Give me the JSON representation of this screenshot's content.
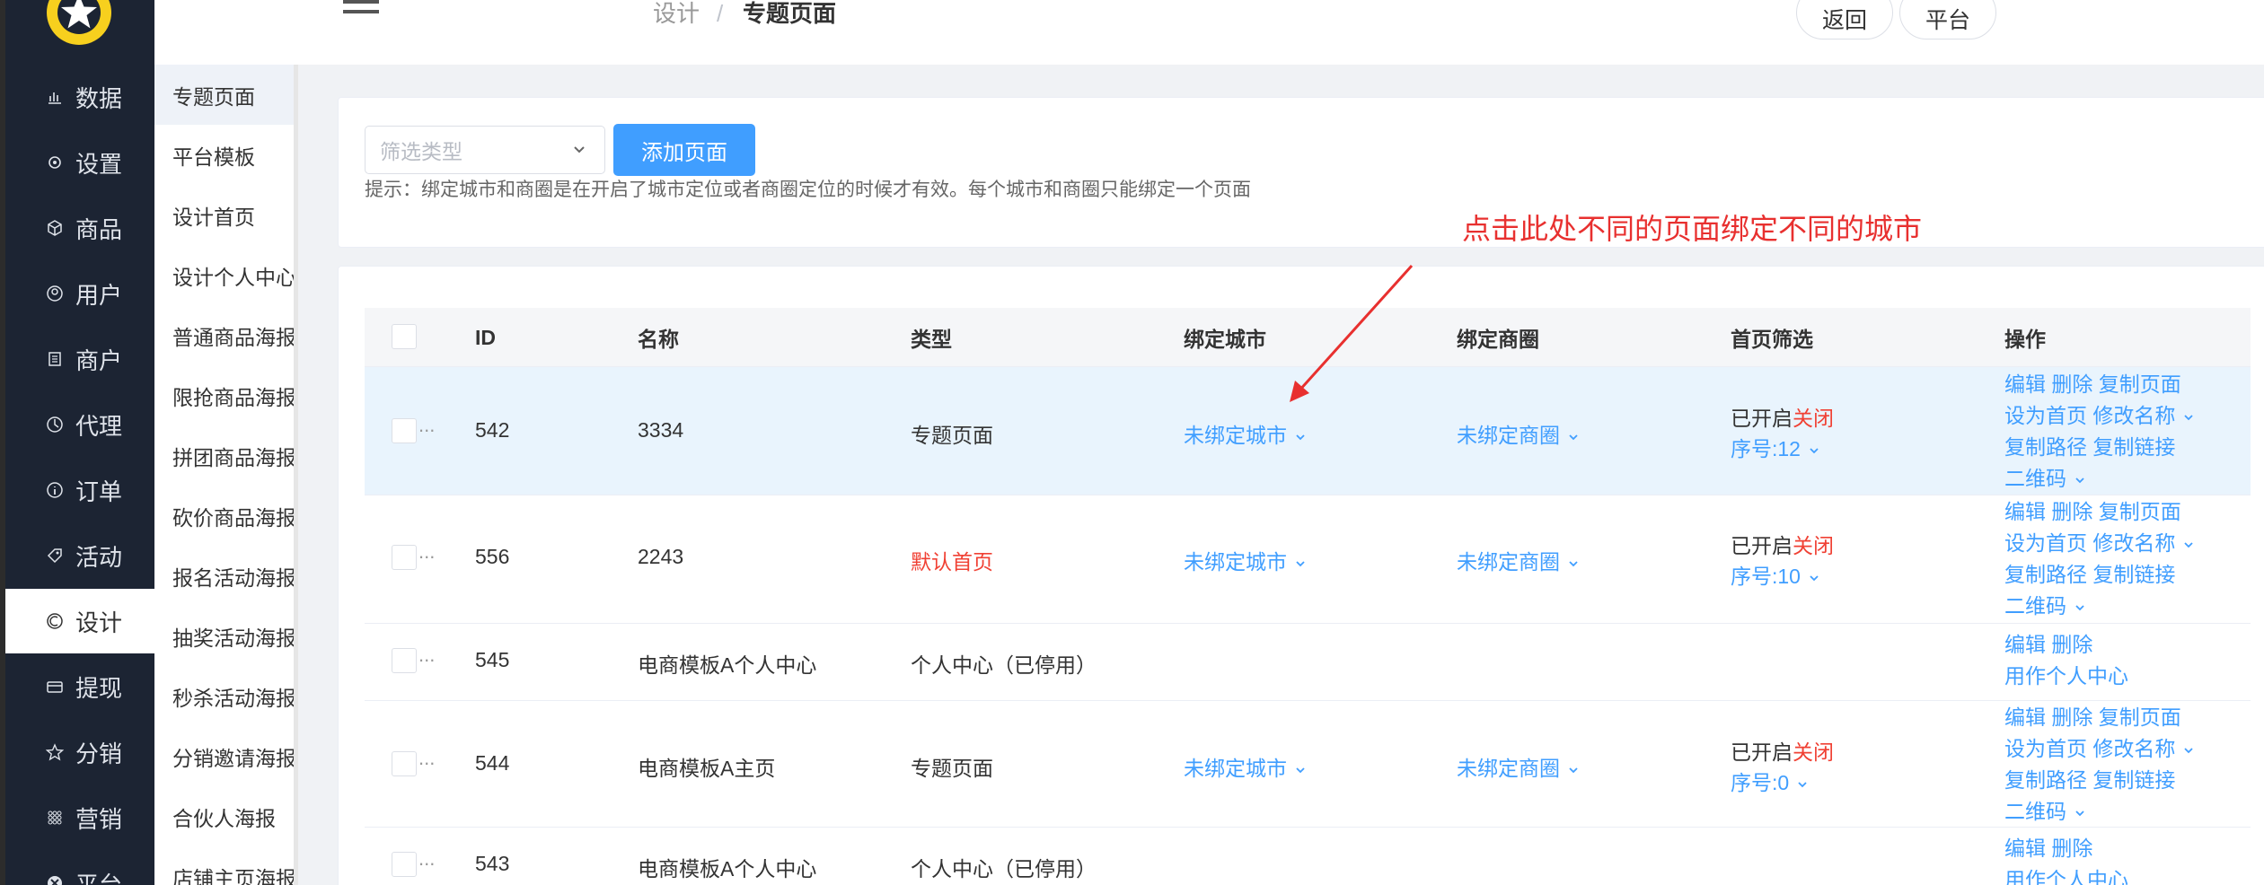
{
  "nav": {
    "items": [
      {
        "label": "数据",
        "icon": "chart-icon"
      },
      {
        "label": "设置",
        "icon": "gear-icon"
      },
      {
        "label": "商品",
        "icon": "cube-icon"
      },
      {
        "label": "用户",
        "icon": "user-icon"
      },
      {
        "label": "商户",
        "icon": "store-icon"
      },
      {
        "label": "代理",
        "icon": "agent-icon"
      },
      {
        "label": "订单",
        "icon": "order-icon"
      },
      {
        "label": "活动",
        "icon": "tag-icon"
      },
      {
        "label": "设计",
        "icon": "design-icon"
      },
      {
        "label": "提现",
        "icon": "card-icon"
      },
      {
        "label": "分销",
        "icon": "star-icon"
      },
      {
        "label": "营销",
        "icon": "grid-icon"
      },
      {
        "label": "平台",
        "icon": "platform-icon"
      }
    ],
    "active": "设计"
  },
  "subnav": {
    "items": [
      "专题页面",
      "平台模板",
      "设计首页",
      "设计个人中心",
      "普通商品海报",
      "限抢商品海报",
      "拼团商品海报",
      "砍价商品海报",
      "报名活动海报",
      "抽奖活动海报",
      "秒杀活动海报",
      "分销邀请海报",
      "合伙人海报",
      "店铺主页海报"
    ]
  },
  "header": {
    "breadcrumb": [
      "设计",
      "/",
      "专题页面"
    ],
    "back_label": "返回",
    "platform_label": "平台"
  },
  "filter": {
    "placeholder": "筛选类型",
    "add_label": "添加页面",
    "tip": "提示：绑定城市和商圈是在开启了城市定位或者商圈定位的时候才有效。每个城市和商圈只能绑定一个页面"
  },
  "annotation": "点击此处不同的页面绑定不同的城市",
  "table": {
    "headers": [
      "ID",
      "名称",
      "类型",
      "绑定城市",
      "绑定商圈",
      "首页筛选",
      "操作"
    ],
    "rows": [
      {
        "id": "542",
        "name": "3334",
        "type": "专题页面",
        "type_red": false,
        "city": "未绑定城市",
        "area": "未绑定商圈",
        "status_on": "已开启",
        "status_off": "关闭",
        "seq": "序号:12",
        "ops": [
          "编辑 删除 复制页面",
          "设为首页 修改名称",
          "复制路径 复制链接",
          "二维码"
        ]
      },
      {
        "id": "556",
        "name": "2243",
        "type": "默认首页",
        "type_red": true,
        "city": "未绑定城市",
        "area": "未绑定商圈",
        "status_on": "已开启",
        "status_off": "关闭",
        "seq": "序号:10",
        "ops": [
          "编辑 删除 复制页面",
          "设为首页 修改名称",
          "复制路径 复制链接",
          "二维码"
        ]
      },
      {
        "id": "545",
        "name": "电商模板A个人中心",
        "type": "个人中心（已停用）",
        "ops": [
          "编辑 删除",
          "用作个人中心"
        ]
      },
      {
        "id": "544",
        "name": "电商模板A主页",
        "type": "专题页面",
        "type_red": false,
        "city": "未绑定城市",
        "area": "未绑定商圈",
        "status_on": "已开启",
        "status_off": "关闭",
        "seq": "序号:0",
        "ops": [
          "编辑 删除 复制页面",
          "设为首页 修改名称",
          "复制路径 复制链接",
          "二维码"
        ]
      },
      {
        "id": "543",
        "name": "电商模板A个人中心",
        "type": "个人中心（已停用）",
        "ops": [
          "编辑 删除",
          "用作个人中心"
        ]
      }
    ]
  },
  "colors": {
    "primary": "#409eff",
    "nav_bg": "#1c2433",
    "danger": "#f04134",
    "logo": "#f7d01e"
  }
}
